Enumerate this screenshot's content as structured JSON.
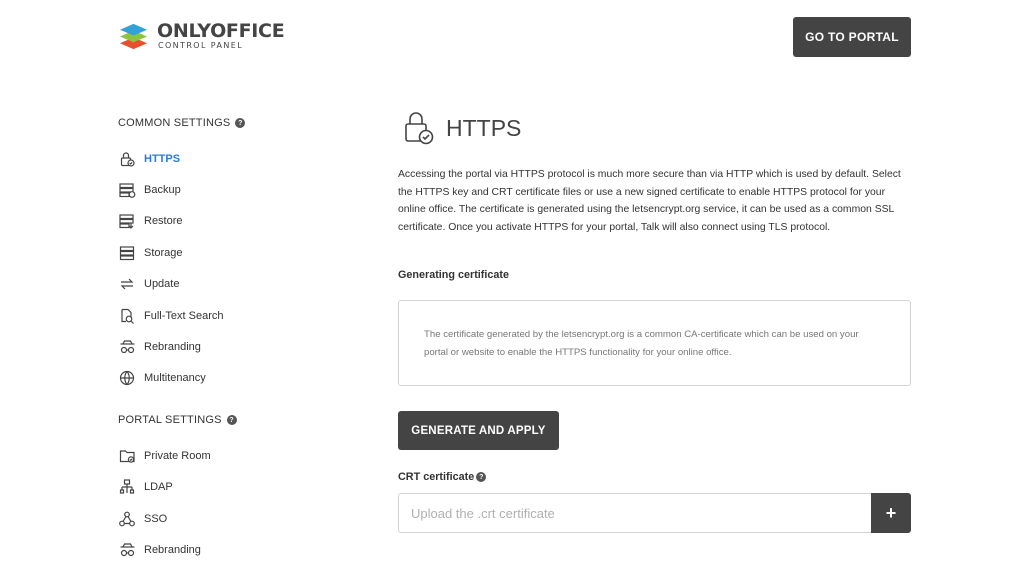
{
  "brand": {
    "name": "ONLYOFFICE",
    "subtitle": "CONTROL PANEL"
  },
  "header": {
    "portal_button": "GO TO PORTAL"
  },
  "sidebar": {
    "common_title": "COMMON SETTINGS",
    "common_items": [
      {
        "label": "HTTPS",
        "icon": "lock-icon",
        "active": true
      },
      {
        "label": "Backup",
        "icon": "backup-icon"
      },
      {
        "label": "Restore",
        "icon": "restore-icon"
      },
      {
        "label": "Storage",
        "icon": "storage-icon"
      },
      {
        "label": "Update",
        "icon": "update-icon"
      },
      {
        "label": "Full-Text Search",
        "icon": "search-doc-icon"
      },
      {
        "label": "Rebranding",
        "icon": "rebranding-icon"
      },
      {
        "label": "Multitenancy",
        "icon": "globe-icon"
      }
    ],
    "portal_title": "PORTAL SETTINGS",
    "portal_items": [
      {
        "label": "Private Room",
        "icon": "private-room-icon"
      },
      {
        "label": "LDAP",
        "icon": "ldap-icon"
      },
      {
        "label": "SSO",
        "icon": "sso-icon"
      },
      {
        "label": "Rebranding",
        "icon": "rebranding-icon"
      }
    ]
  },
  "main": {
    "title": "HTTPS",
    "description": "Accessing the portal via HTTPS protocol is much more secure than via HTTP which is used by default. Select the HTTPS key and CRT certificate files or use a new signed certificate to enable HTTPS protocol for your online office. The certificate is generated using the letsencrypt.org service, it can be used as a common SSL certificate. Once you activate HTTPS for your portal, Talk will also connect using TLS protocol.",
    "generating_label": "Generating certificate",
    "info_text": "The certificate generated by the letsencrypt.org is a common CA-certificate which can be used on your portal or website to enable the HTTPS functionality for your online office.",
    "generate_button": "GENERATE AND APPLY",
    "crt_label": "CRT certificate",
    "crt_placeholder": "Upload the .crt certificate",
    "crt_add": "+"
  },
  "colors": {
    "accent": "#2d7ad6",
    "dark_button": "#444444",
    "text": "#333333"
  }
}
